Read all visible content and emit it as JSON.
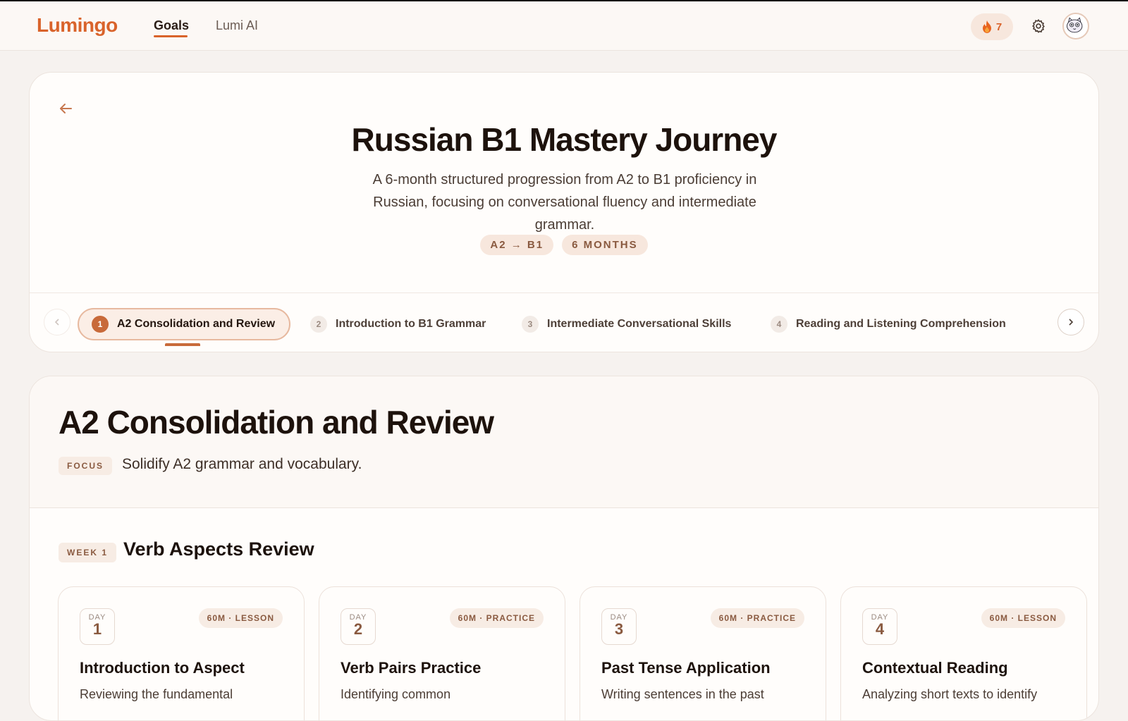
{
  "header": {
    "logo": "Lumingo",
    "nav": [
      {
        "label": "Goals",
        "active": true
      },
      {
        "label": "Lumi AI",
        "active": false
      }
    ],
    "streak_count": "7",
    "icons": [
      "flame-icon",
      "gear-icon",
      "avatar"
    ]
  },
  "goal": {
    "title": "Russian B1 Mastery Journey",
    "description": "A 6-month structured progression from A2 to B1 proficiency in Russian, focusing on conversational fluency and intermediate grammar.",
    "pills": [
      "A2 → B1",
      "6 MONTHS"
    ]
  },
  "phases": [
    {
      "num": "1",
      "label": "A2 Consolidation and Review",
      "active": true
    },
    {
      "num": "2",
      "label": "Introduction to B1 Grammar",
      "active": false
    },
    {
      "num": "3",
      "label": "Intermediate Conversational Skills",
      "active": false
    },
    {
      "num": "4",
      "label": "Reading and Listening Comprehension",
      "active": false
    }
  ],
  "phase_detail": {
    "title": "A2 Consolidation and Review",
    "focus_label": "FOCUS",
    "focus_text": "Solidify A2 grammar and vocabulary.",
    "week_label": "WEEK 1",
    "week_title": "Verb Aspects Review",
    "days": [
      {
        "day_label": "DAY",
        "num": "1",
        "tag": "60M · LESSON",
        "title": "Introduction to Aspect",
        "desc": "Reviewing the fundamental"
      },
      {
        "day_label": "DAY",
        "num": "2",
        "tag": "60M · PRACTICE",
        "title": "Verb Pairs Practice",
        "desc": "Identifying common"
      },
      {
        "day_label": "DAY",
        "num": "3",
        "tag": "60M · PRACTICE",
        "title": "Past Tense Application",
        "desc": "Writing sentences in the past"
      },
      {
        "day_label": "DAY",
        "num": "4",
        "tag": "60M · LESSON",
        "title": "Contextual Reading",
        "desc": "Analyzing short texts to identify"
      }
    ]
  },
  "colors": {
    "accent": "#d9632b",
    "accent_dark": "#c86a3a",
    "pill_bg": "#f7e7dd",
    "page_bg": "#f6f2ef"
  }
}
